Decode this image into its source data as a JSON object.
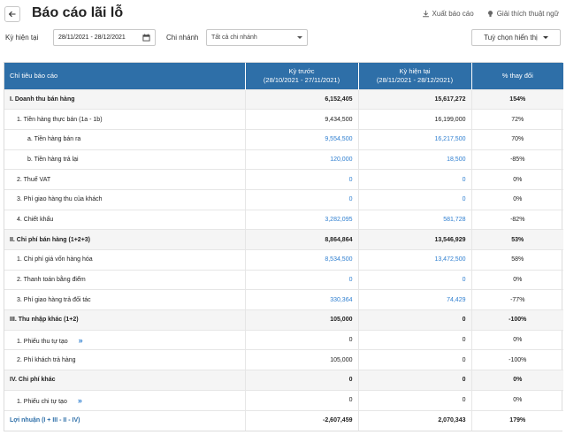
{
  "header": {
    "title": "Báo cáo lãi lỗ",
    "export_label": "Xuất báo cáo",
    "glossary_label": "Giải thích thuật ngữ"
  },
  "filters": {
    "period_label": "Kỳ hiện tại",
    "period_value": "28/11/2021 - 28/12/2021",
    "branch_label": "Chi nhánh",
    "branch_value": "Tất cả chi nhánh",
    "view_options_label": "Tuỳ chọn hiển thị"
  },
  "table": {
    "columns": {
      "name": "Chỉ tiêu báo cáo",
      "prev_title": "Kỳ trước",
      "prev_range": "(28/10/2021 - 27/11/2021)",
      "curr_title": "Kỳ hiện tại",
      "curr_range": "(28/11/2021 - 28/12/2021)",
      "change": "% thay đổi"
    },
    "rows": [
      {
        "name": "I. Doanh thu bán hàng",
        "level": 0,
        "prev": "6,152,405",
        "curr": "15,617,272",
        "change": "154%",
        "link": false
      },
      {
        "name": "1. Tiền hàng thực bán (1a - 1b)",
        "level": 1,
        "prev": "9,434,500",
        "curr": "16,199,000",
        "change": "72%",
        "link": false
      },
      {
        "name": "a. Tiền hàng bán ra",
        "level": 2,
        "prev": "9,554,500",
        "curr": "16,217,500",
        "change": "70%",
        "link": true
      },
      {
        "name": "b. Tiền hàng trả lại",
        "level": 2,
        "prev": "120,000",
        "curr": "18,500",
        "change": "-85%",
        "link": true
      },
      {
        "name": "2. Thuế VAT",
        "level": 1,
        "prev": "0",
        "curr": "0",
        "change": "0%",
        "link": true
      },
      {
        "name": "3. Phí giao hàng thu của khách",
        "level": 1,
        "prev": "0",
        "curr": "0",
        "change": "0%",
        "link": true
      },
      {
        "name": "4. Chiết khấu",
        "level": 1,
        "prev": "3,282,095",
        "curr": "581,728",
        "change": "-82%",
        "link": true
      },
      {
        "name": "II. Chi phí bán hàng (1+2+3)",
        "level": 0,
        "prev": "8,864,864",
        "curr": "13,546,929",
        "change": "53%",
        "link": false
      },
      {
        "name": "1. Chi phí giá vốn hàng hóa",
        "level": 1,
        "prev": "8,534,500",
        "curr": "13,472,500",
        "change": "58%",
        "link": true
      },
      {
        "name": "2. Thanh toán bằng điểm",
        "level": 1,
        "prev": "0",
        "curr": "0",
        "change": "0%",
        "link": true
      },
      {
        "name": "3. Phí giao hàng trả đối tác",
        "level": 1,
        "prev": "330,364",
        "curr": "74,429",
        "change": "-77%",
        "link": true
      },
      {
        "name": "III. Thu nhập khác (1+2)",
        "level": 0,
        "prev": "105,000",
        "curr": "0",
        "change": "-100%",
        "link": false
      },
      {
        "name": "1. Phiếu thu tự tạo",
        "level": 1,
        "prev": "0",
        "curr": "0",
        "change": "0%",
        "link": false,
        "chevron": "»"
      },
      {
        "name": "2. Phí khách trả hàng",
        "level": 1,
        "prev": "105,000",
        "curr": "0",
        "change": "-100%",
        "link": false
      },
      {
        "name": "IV. Chi phí khác",
        "level": 0,
        "prev": "0",
        "curr": "0",
        "change": "0%",
        "link": false
      },
      {
        "name": "1. Phiếu chi tự tạo",
        "level": 1,
        "prev": "0",
        "curr": "0",
        "change": "0%",
        "link": false,
        "chevron": "»"
      }
    ],
    "total": {
      "name": "Lợi nhuận (I + III - II - IV)",
      "prev": "-2,607,459",
      "curr": "2,070,343",
      "change": "179%"
    }
  },
  "colors": {
    "header_bg": "#2e6fa8",
    "link": "#2f7fd0"
  }
}
